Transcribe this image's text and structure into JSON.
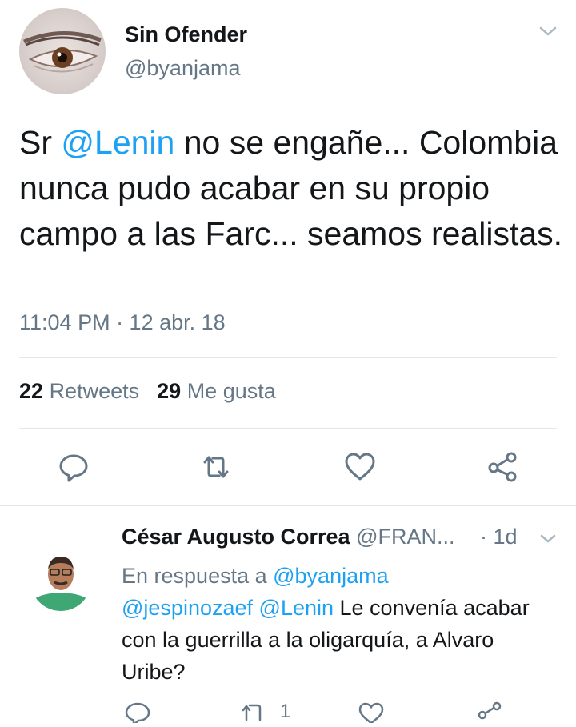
{
  "tweet": {
    "display_name": "Sin Ofender",
    "handle": "@byanjama",
    "text_before": "Sr ",
    "mention": "@Lenin",
    "text_after": " no se engañe... Colombia nunca pudo acabar en su propio campo a las Farc... seamos realistas.",
    "timestamp": "11:04 PM · 12 abr. 18",
    "retweets_count": "22",
    "retweets_label": "Retweets",
    "likes_count": "29",
    "likes_label": "Me gusta"
  },
  "reply": {
    "display_name": "César Augusto Correa",
    "handle": "@FRAN...",
    "time": "· 1d",
    "replying_label": "En respuesta a ",
    "replying_to": "@byanjama",
    "mention_1": "@jespinozaef",
    "mention_2": "@Lenin",
    "text": " Le convenía acabar con la guerrilla a la oligarquía, a Alvaro Uribe?",
    "retweet_count": "1"
  },
  "icons": {
    "reply": "reply-icon",
    "retweet": "retweet-icon",
    "like": "heart-icon",
    "share": "share-icon",
    "caret": "chevron-down-icon"
  },
  "colors": {
    "accent": "#1da1f2",
    "secondary_text": "#657786",
    "divider": "#e1e8ed"
  }
}
